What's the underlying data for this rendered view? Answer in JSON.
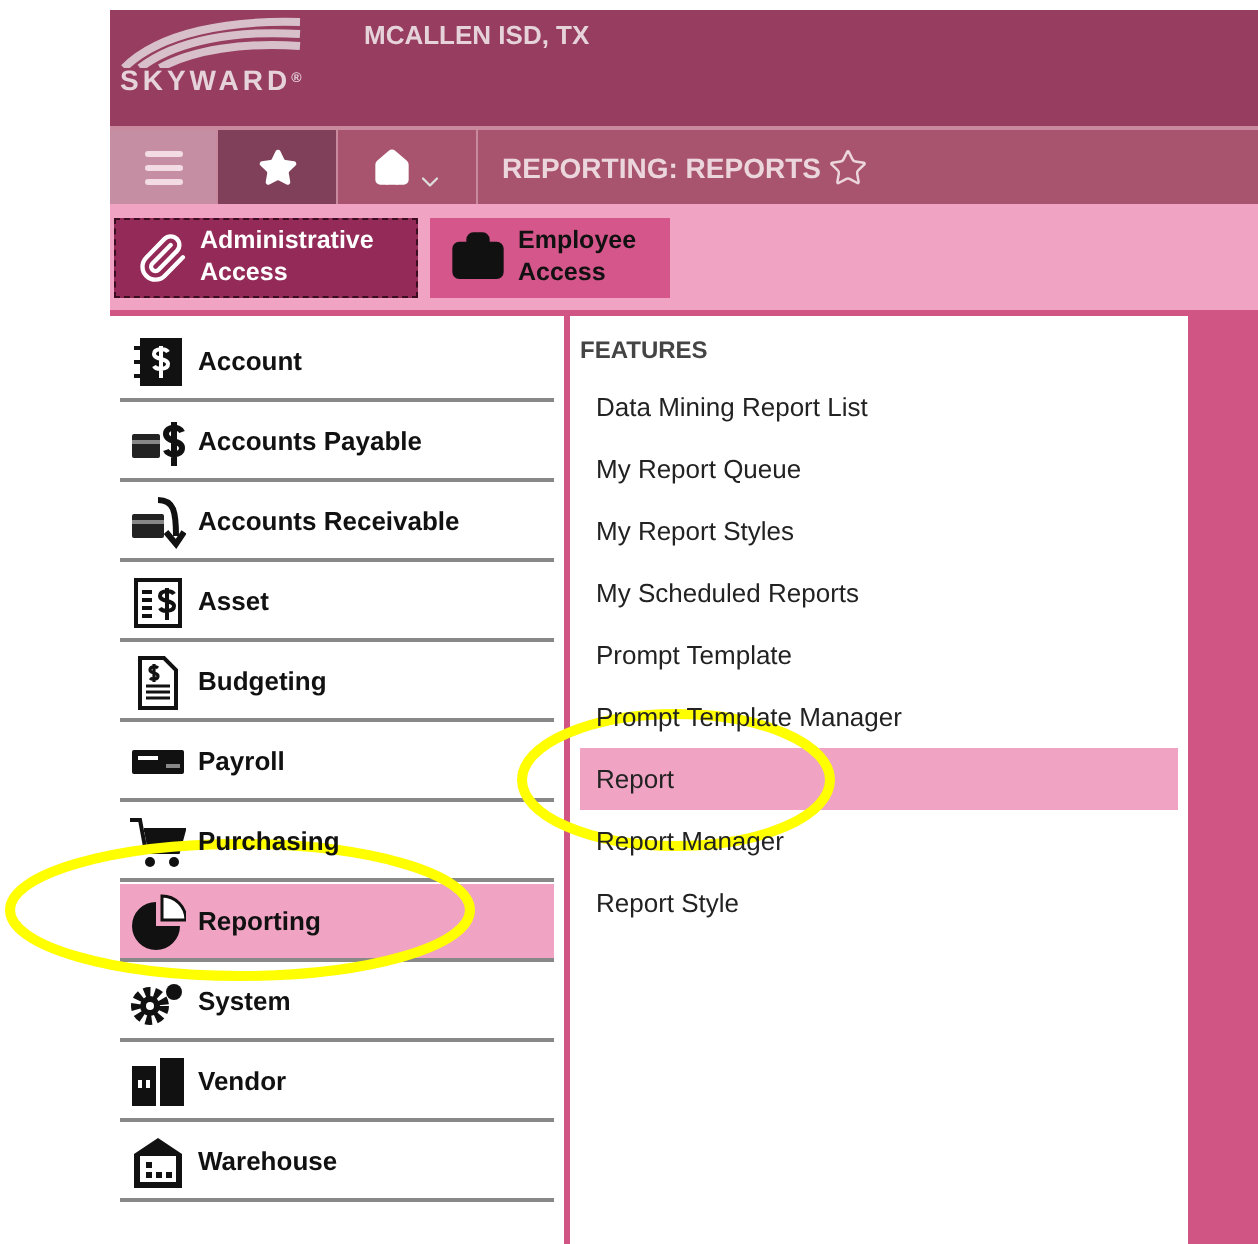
{
  "header": {
    "logo": "SKYWARD",
    "registered": "®",
    "district": "MCALLEN ISD, TX"
  },
  "nav": {
    "title": "REPORTING: REPORTS",
    "buttons": [
      {
        "kind": "menu",
        "selected": false
      },
      {
        "kind": "favorites",
        "selected": true
      },
      {
        "kind": "home",
        "selected": false
      }
    ]
  },
  "access": [
    {
      "label": "Administrative Access",
      "selected": true
    },
    {
      "label": "Employee Access",
      "selected": false
    }
  ],
  "modules": [
    {
      "label": "Account",
      "selected": false
    },
    {
      "label": "Accounts Payable",
      "selected": false
    },
    {
      "label": "Accounts Receivable",
      "selected": false
    },
    {
      "label": "Asset",
      "selected": false
    },
    {
      "label": "Budgeting",
      "selected": false
    },
    {
      "label": "Payroll",
      "selected": false
    },
    {
      "label": "Purchasing",
      "selected": false
    },
    {
      "label": "Reporting",
      "selected": true
    },
    {
      "label": "System",
      "selected": false
    },
    {
      "label": "Vendor",
      "selected": false
    },
    {
      "label": "Warehouse",
      "selected": false
    }
  ],
  "features": {
    "heading": "FEATURES",
    "items": [
      {
        "label": "Data Mining Report List",
        "selected": false
      },
      {
        "label": "My Report Queue",
        "selected": false
      },
      {
        "label": "My Report Styles",
        "selected": false
      },
      {
        "label": "My Scheduled Reports",
        "selected": false
      },
      {
        "label": "Prompt Template",
        "selected": false
      },
      {
        "label": "Prompt Template Manager",
        "selected": false
      },
      {
        "label": "Report",
        "selected": true
      },
      {
        "label": "Report Manager",
        "selected": false
      },
      {
        "label": "Report Style",
        "selected": false
      }
    ]
  }
}
